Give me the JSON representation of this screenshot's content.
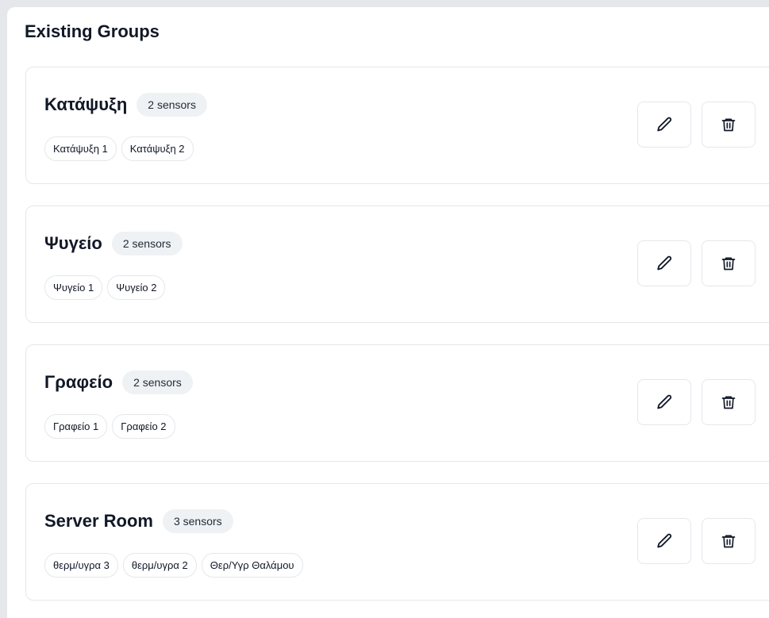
{
  "title": "Existing Groups",
  "groups": [
    {
      "name": "Κατάψυξη",
      "count": "2 sensors",
      "sensors": [
        "Κατάψυξη 1",
        "Κατάψυξη 2"
      ],
      "actions": [
        "pencil-icon",
        "trash-icon"
      ]
    },
    {
      "name": "Ψυγείο",
      "count": "2 sensors",
      "sensors": [
        "Ψυγείο 1",
        "Ψυγείο 2"
      ],
      "actions": [
        "pencil-icon",
        "trash-icon"
      ]
    },
    {
      "name": "Γραφείο",
      "count": "2 sensors",
      "sensors": [
        "Γραφείο 1",
        "Γραφείο 2"
      ],
      "actions": [
        "pencil-icon",
        "trash-icon"
      ]
    },
    {
      "name": "Server Room",
      "count": "3 sensors",
      "sensors": [
        "θερμ/υγρα 3",
        "θερμ/υγρα 2",
        "Θερ/Υγρ Θαλάμου"
      ],
      "actions": [
        "pencil-icon",
        "trash-icon"
      ]
    }
  ],
  "colors": {
    "background": "#e5e7eb",
    "panel": "#ffffff",
    "border": "#e5e7eb",
    "badge": "#eef2f4",
    "text": "#111827"
  }
}
